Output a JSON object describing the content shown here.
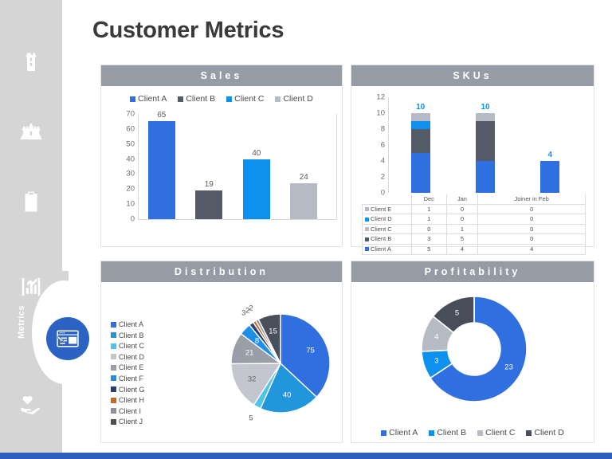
{
  "page": {
    "title": "Customer Metrics",
    "accent_blue": "#2c62c4",
    "bar_blue": "#2f6fe0",
    "cyan": "#0d90ee",
    "dark_slate": "#545a66",
    "light_grey": "#b6bac4",
    "header_grey": "#969ca5",
    "sidebar_grey": "#d5d5d5",
    "bottom_bar_color": "#2f5fbe"
  },
  "sidebar": {
    "vertical_label": "Metrics",
    "items": [
      {
        "name": "tower-icon",
        "label": "Tower"
      },
      {
        "name": "castle-icon",
        "label": "Castle"
      },
      {
        "name": "clipboard-icon",
        "label": "Clipboard"
      },
      {
        "name": "bar-chart-icon",
        "label": "Chart"
      },
      {
        "name": "hand-heart-icon",
        "label": "Care"
      }
    ],
    "badge_icon": "presentation-window-icon"
  },
  "panels": {
    "sales": {
      "title": "Sales"
    },
    "skus": {
      "title": "SKUs"
    },
    "distribution": {
      "title": "Distribution"
    },
    "profitability": {
      "title": "Profitability"
    }
  },
  "chart_data": [
    {
      "id": "sales",
      "type": "bar",
      "title": "Sales",
      "categories": [
        "Client A",
        "Client B",
        "Client C",
        "Client D"
      ],
      "values": [
        65,
        19,
        40,
        24
      ],
      "colors": [
        "#2f6fe0",
        "#545a66",
        "#0d90ee",
        "#b6bac4"
      ],
      "legend": [
        "Client A",
        "Client B",
        "Client C",
        "Client D"
      ],
      "legend_position": "top",
      "yticks": [
        0,
        10,
        20,
        30,
        40,
        50,
        60,
        70
      ],
      "ylim": [
        0,
        70
      ],
      "xlabel": "",
      "ylabel": "",
      "grid": false
    },
    {
      "id": "skus",
      "type": "bar",
      "subtype": "stacked",
      "title": "SKUs",
      "categories": [
        "Dec",
        "Jan",
        "Joiner in Feb"
      ],
      "series": [
        {
          "name": "Client A",
          "values": [
            5,
            4,
            4
          ],
          "color": "#2f6fe0"
        },
        {
          "name": "Client B",
          "values": [
            3,
            5,
            0
          ],
          "color": "#545a66"
        },
        {
          "name": "Client C",
          "values": [
            0,
            1,
            0
          ],
          "color": "#b6bac4"
        },
        {
          "name": "Client D",
          "values": [
            1,
            0,
            0
          ],
          "color": "#0d90ee"
        },
        {
          "name": "Client E",
          "values": [
            1,
            0,
            0
          ],
          "color": "#b6bac4"
        }
      ],
      "totals": [
        10,
        10,
        4
      ],
      "total_label_color": "#0d90ee",
      "yticks": [
        0,
        2,
        4,
        6,
        8,
        10,
        12
      ],
      "ylim": [
        0,
        12
      ],
      "show_data_table": true,
      "table": {
        "columns": [
          "",
          "Dec",
          "Jan",
          "Joiner in Feb"
        ],
        "rows": [
          {
            "label": "Client E",
            "color": "#b6bac4",
            "values": [
              "1",
              "0",
              "0"
            ]
          },
          {
            "label": "Client D",
            "color": "#0d90ee",
            "values": [
              "1",
              "0",
              "0"
            ]
          },
          {
            "label": "Client C",
            "color": "#b6bac4",
            "values": [
              "0",
              "1",
              "0"
            ]
          },
          {
            "label": "Client B",
            "color": "#545a66",
            "values": [
              "3",
              "5",
              "0"
            ]
          },
          {
            "label": "Client A",
            "color": "#2f6fe0",
            "values": [
              "5",
              "4",
              "4"
            ]
          }
        ]
      }
    },
    {
      "id": "distribution",
      "type": "pie",
      "title": "Distribution",
      "labels": [
        "Client A",
        "Client B",
        "Client C",
        "Client D",
        "Client E",
        "Client F",
        "Client G",
        "Client H",
        "Client I",
        "Client J"
      ],
      "values": [
        75,
        40,
        5,
        32,
        21,
        8,
        3,
        2,
        2,
        15
      ],
      "colors": [
        "#2f6fe0",
        "#2196dd",
        "#4fc3e8",
        "#c3c6cf",
        "#9a9ea8",
        "#1e8fe8",
        "#2a3f73",
        "#c9661f",
        "#8d9099",
        "#4a4f5c"
      ],
      "legend_position": "left",
      "data_labels": [
        75,
        40,
        5,
        32,
        21,
        8,
        3,
        2,
        2,
        15
      ]
    },
    {
      "id": "profitability",
      "type": "pie",
      "subtype": "donut",
      "title": "Profitability",
      "labels": [
        "Client A",
        "Client B",
        "Client C",
        "Client D"
      ],
      "values": [
        23,
        3,
        4,
        5
      ],
      "colors": [
        "#2f6fe0",
        "#0d90ee",
        "#b6bac4",
        "#474d59"
      ],
      "legend_position": "bottom",
      "data_labels": [
        23,
        3,
        4,
        5
      ]
    }
  ]
}
